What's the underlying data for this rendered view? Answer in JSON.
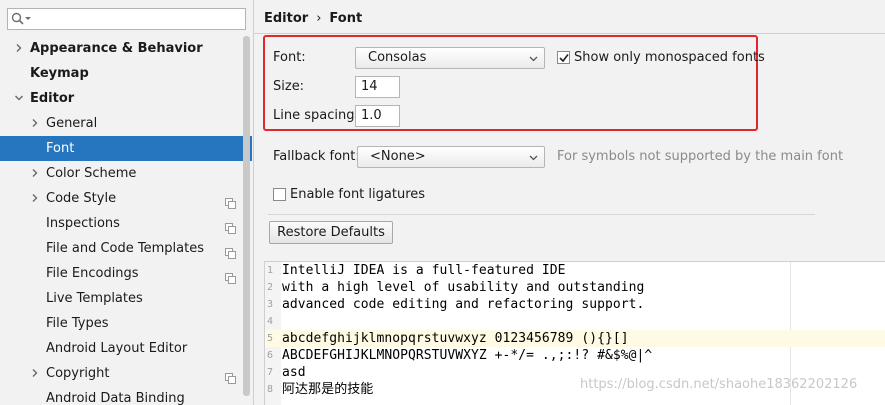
{
  "search": {
    "value": "",
    "icon": "search-icon"
  },
  "sidebar": {
    "items": [
      {
        "label": "Appearance & Behavior",
        "bold": true,
        "arrow": "right",
        "level": 0,
        "copy_icon": false,
        "selected": false
      },
      {
        "label": "Keymap",
        "bold": true,
        "arrow": "none",
        "level": 0,
        "copy_icon": false,
        "selected": false
      },
      {
        "label": "Editor",
        "bold": true,
        "arrow": "down",
        "level": 0,
        "copy_icon": false,
        "selected": false
      },
      {
        "label": "General",
        "bold": false,
        "arrow": "right",
        "level": 1,
        "copy_icon": false,
        "selected": false
      },
      {
        "label": "Font",
        "bold": false,
        "arrow": "none",
        "level": 1,
        "copy_icon": false,
        "selected": true
      },
      {
        "label": "Color Scheme",
        "bold": false,
        "arrow": "right",
        "level": 1,
        "copy_icon": false,
        "selected": false
      },
      {
        "label": "Code Style",
        "bold": false,
        "arrow": "right",
        "level": 1,
        "copy_icon": true,
        "selected": false
      },
      {
        "label": "Inspections",
        "bold": false,
        "arrow": "none",
        "level": 1,
        "copy_icon": true,
        "selected": false
      },
      {
        "label": "File and Code Templates",
        "bold": false,
        "arrow": "none",
        "level": 1,
        "copy_icon": true,
        "selected": false
      },
      {
        "label": "File Encodings",
        "bold": false,
        "arrow": "none",
        "level": 1,
        "copy_icon": true,
        "selected": false
      },
      {
        "label": "Live Templates",
        "bold": false,
        "arrow": "none",
        "level": 1,
        "copy_icon": false,
        "selected": false
      },
      {
        "label": "File Types",
        "bold": false,
        "arrow": "none",
        "level": 1,
        "copy_icon": false,
        "selected": false
      },
      {
        "label": "Android Layout Editor",
        "bold": false,
        "arrow": "none",
        "level": 1,
        "copy_icon": false,
        "selected": false
      },
      {
        "label": "Copyright",
        "bold": false,
        "arrow": "right",
        "level": 1,
        "copy_icon": true,
        "selected": false
      },
      {
        "label": "Android Data Binding",
        "bold": false,
        "arrow": "none",
        "level": 1,
        "copy_icon": false,
        "selected": false
      }
    ]
  },
  "breadcrumb": {
    "parent": "Editor",
    "separator": "›",
    "current": "Font"
  },
  "font_settings": {
    "font_label": "Font:",
    "font_value": "Consolas",
    "monospaced_label": "Show only monospaced fonts",
    "monospaced_checked": true,
    "size_label": "Size:",
    "size_value": "14",
    "line_spacing_label": "Line spacing:",
    "line_spacing_value": "1.0"
  },
  "fallback": {
    "label": "Fallback font:",
    "value": "<None>",
    "hint": "For symbols not supported by the main font"
  },
  "ligatures": {
    "label": "Enable font ligatures",
    "checked": false
  },
  "restore_button": "Restore Defaults",
  "preview": {
    "current_line": 5,
    "lines": [
      {
        "num": "1",
        "text": "IntelliJ IDEA is a full-featured IDE"
      },
      {
        "num": "2",
        "text": "with a high level of usability and outstanding"
      },
      {
        "num": "3",
        "text": "advanced code editing and refactoring support."
      },
      {
        "num": "4",
        "text": ""
      },
      {
        "num": "5",
        "text": "abcdefghijklmnopqrstuvwxyz 0123456789 (){}[]"
      },
      {
        "num": "6",
        "text": "ABCDEFGHIJKLMNOPQRSTUVWXYZ +-*/= .,;:!? #&$%@|^"
      },
      {
        "num": "7",
        "text": "asd"
      },
      {
        "num": "8",
        "text": "阿达那是的技能"
      }
    ]
  },
  "watermark": "https://blog.csdn.net/shaohe18362202126",
  "colors": {
    "selection": "#2675bf",
    "highlight_box": "#e3262b",
    "current_line": "#fffae3",
    "hint_text": "#8a8a8a"
  }
}
